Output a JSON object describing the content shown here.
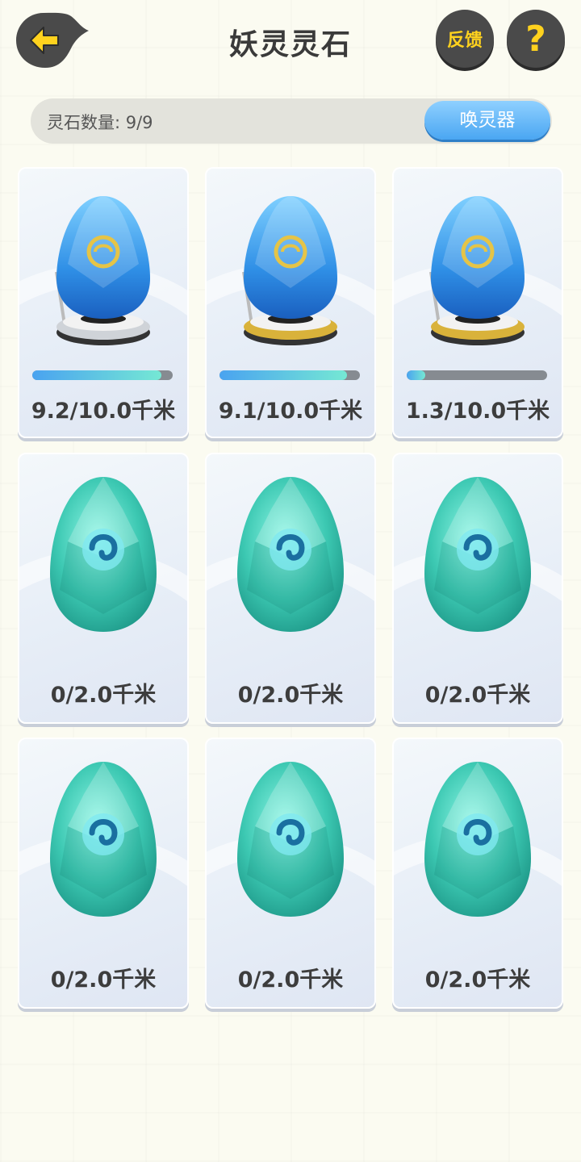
{
  "header": {
    "title": "妖灵灵石",
    "feedback_label": "反馈",
    "help_label": "?"
  },
  "summary": {
    "count_label": "灵石数量: 9/9",
    "summon_label": "唤灵器"
  },
  "eggs": [
    {
      "distance": "9.2/10.0千米",
      "progress": 0.92,
      "type": "incubating",
      "stand": "silver"
    },
    {
      "distance": "9.1/10.0千米",
      "progress": 0.91,
      "type": "incubating",
      "stand": "gold"
    },
    {
      "distance": "1.3/10.0千米",
      "progress": 0.13,
      "type": "incubating",
      "stand": "gold"
    },
    {
      "distance": "0/2.0千米",
      "type": "idle"
    },
    {
      "distance": "0/2.0千米",
      "type": "idle"
    },
    {
      "distance": "0/2.0千米",
      "type": "idle"
    },
    {
      "distance": "0/2.0千米",
      "type": "idle"
    },
    {
      "distance": "0/2.0千米",
      "type": "idle"
    },
    {
      "distance": "0/2.0千米",
      "type": "idle"
    }
  ],
  "colors": {
    "accent_yellow": "#ffd21e",
    "button_dark": "#4a4a4a",
    "summon_blue": "#4aa6f2",
    "progress_start": "#4aa3f0",
    "progress_end": "#75e8d4"
  }
}
